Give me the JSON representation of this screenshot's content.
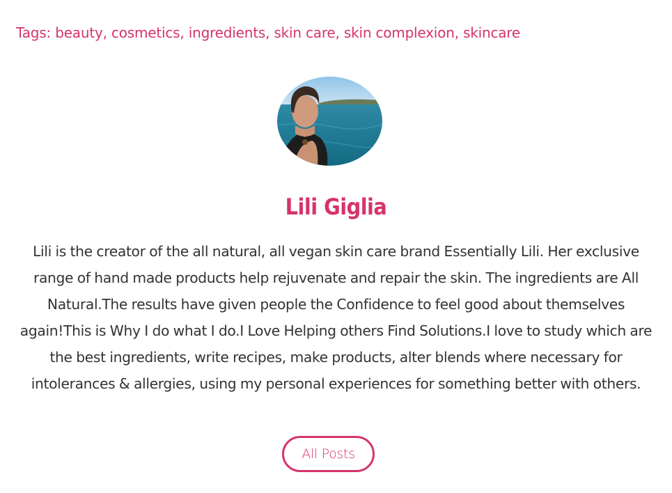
{
  "tags": {
    "prefix": "Tags:",
    "items": [
      "beauty",
      "cosmetics",
      "ingredients",
      "skin care",
      "skin complexion",
      "skincare"
    ]
  },
  "author": {
    "name": "Lili Giglia",
    "bio": "Lili is the creator of the all natural, all vegan skin care brand Essentially Lili. Her exclusive range of hand made products help rejuvenate and repair the skin. The ingredients are All Natural.The results have given people the Confidence to feel good about themselves again!This is Why I do what I do.I Love Helping others Find Solutions.I love to study which are the best ingredients, write recipes, make products, alter blends where necessary for intolerances & allergies, using my personal experiences for something better with others.",
    "all_posts_label": "All Posts"
  },
  "colors": {
    "accent": "#d6336c",
    "text": "#333333"
  }
}
